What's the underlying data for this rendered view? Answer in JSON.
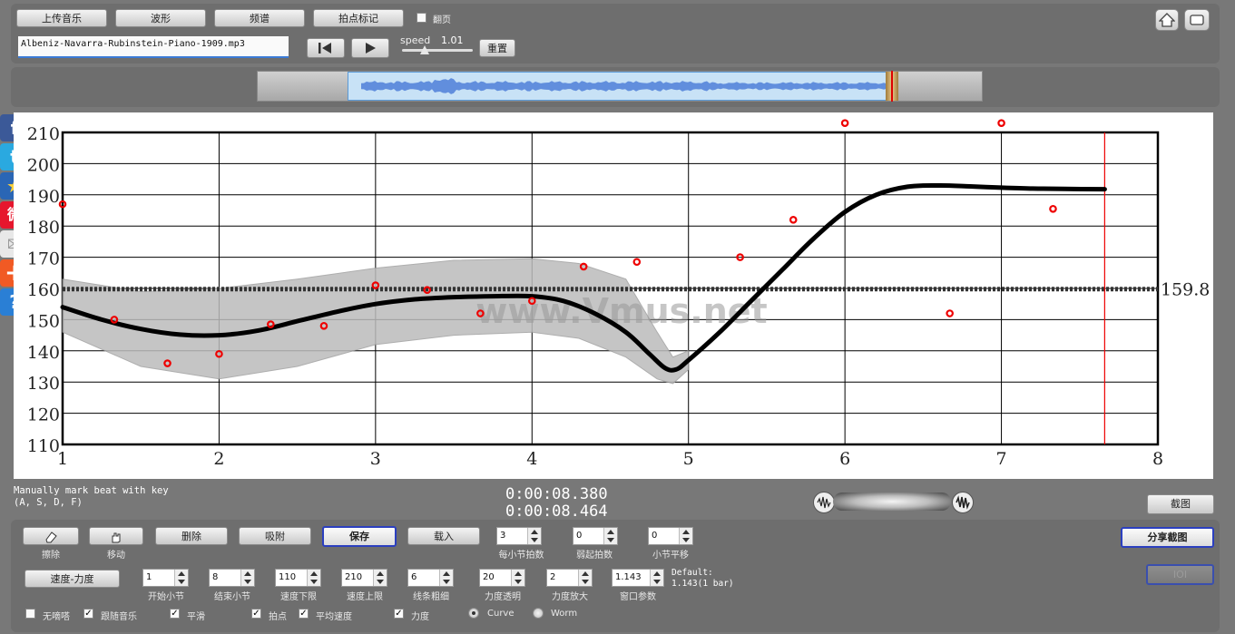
{
  "toolbar": {
    "upload": "上传音乐",
    "waveform": "波形",
    "spectrum": "频谱",
    "beat_mark": "拍点标记",
    "page_turn": "翻页",
    "file_name": "Albeniz-Navarra-Rubinstein-Piano-1909.mp3",
    "speed_label": "speed",
    "speed_value": "1.01",
    "reset": "重置"
  },
  "chart_data": {
    "type": "line",
    "xlim": [
      1,
      8
    ],
    "ylim": [
      110,
      210
    ],
    "x_ticks": [
      "1",
      "2",
      "3",
      "4",
      "5",
      "6",
      "7",
      "8"
    ],
    "y_ticks": [
      "110",
      "120",
      "130",
      "140",
      "150",
      "160",
      "170",
      "180",
      "190",
      "200",
      "210"
    ],
    "average_label": "159.8",
    "average": 159.8,
    "cursor_x": 7.66,
    "watermark": "www.Vmus.net",
    "series": [
      {
        "x": [
          1,
          1.25,
          1.5,
          1.75,
          2,
          2.25,
          2.5,
          2.75,
          3,
          3.25,
          3.5,
          3.75,
          4,
          4.2,
          4.4,
          4.6,
          4.75,
          4.85,
          4.92,
          5,
          5.2,
          5.4,
          5.6,
          5.8,
          6,
          6.2,
          6.4,
          6.6,
          6.8,
          7,
          7.2,
          7.4,
          7.66
        ],
        "y": [
          154,
          150,
          147,
          145.2,
          145,
          146.5,
          149.5,
          152.5,
          155,
          156.5,
          157.2,
          157.5,
          157.5,
          156,
          152,
          146,
          139,
          134.5,
          134,
          137,
          146,
          156,
          166,
          176,
          184.5,
          190,
          192.6,
          193,
          192.7,
          192.3,
          192,
          191.9,
          191.8
        ]
      }
    ],
    "band": {
      "x": [
        1,
        1.5,
        2,
        2.5,
        3,
        3.5,
        4,
        4.3,
        4.6,
        4.8,
        4.9,
        5
      ],
      "upper": [
        163,
        159,
        160,
        163,
        166.5,
        169,
        169.5,
        168,
        163,
        146,
        138,
        140
      ],
      "lower": [
        146,
        135,
        131,
        135,
        142,
        145,
        146,
        144,
        138,
        131,
        129.5,
        134
      ]
    },
    "points": {
      "x": [
        1,
        1.33,
        1.67,
        2,
        2.33,
        2.67,
        3,
        3.33,
        3.67,
        4,
        4.33,
        4.67,
        5.33,
        5.67,
        6,
        6.67,
        7,
        7.33
      ],
      "y": [
        187,
        150,
        136,
        139,
        148.5,
        148,
        161,
        159.5,
        152,
        156,
        167,
        168.5,
        170,
        182,
        213,
        152,
        213,
        185.5
      ]
    }
  },
  "status": {
    "hint_line1": "Manually mark beat with key",
    "hint_line2": "(A, S, D, F)",
    "time1": "0:00:08.380",
    "time2": "0:00:08.464",
    "screenshot": "截图"
  },
  "controls": {
    "erase": "擦除",
    "move": "移动",
    "delete": "删除",
    "attach": "吸附",
    "save": "保存",
    "load": "载入",
    "beats_per_bar_value": "3",
    "beats_per_bar": "每小节拍数",
    "pickup_value": "0",
    "pickup": "弱起拍数",
    "bar_shift_value": "0",
    "bar_shift": "小节平移",
    "share_screenshot": "分享截图",
    "ioi": "IOI",
    "speed_force": "速度-力度",
    "start_bar_value": "1",
    "start_bar": "开始小节",
    "end_bar_value": "8",
    "end_bar": "结束小节",
    "speed_min_value": "110",
    "speed_min": "速度下限",
    "speed_max_value": "210",
    "speed_max": "速度上限",
    "line_width_value": "6",
    "line_width": "线条粗细",
    "force_alpha_value": "20",
    "force_alpha": "力度透明",
    "force_scale_value": "2",
    "force_scale": "力度放大",
    "window_param_value": "1.143",
    "window_param": "窗口参数",
    "default_line1": "Default:",
    "default_line2": "1.143(1 bar)",
    "no_scrub": "无嘀嗒",
    "follow_music": "跟随音乐",
    "smooth": "平滑",
    "beat_points": "拍点",
    "avg_speed": "平均速度",
    "force": "力度",
    "curve": "Curve",
    "worm": "Worm"
  }
}
